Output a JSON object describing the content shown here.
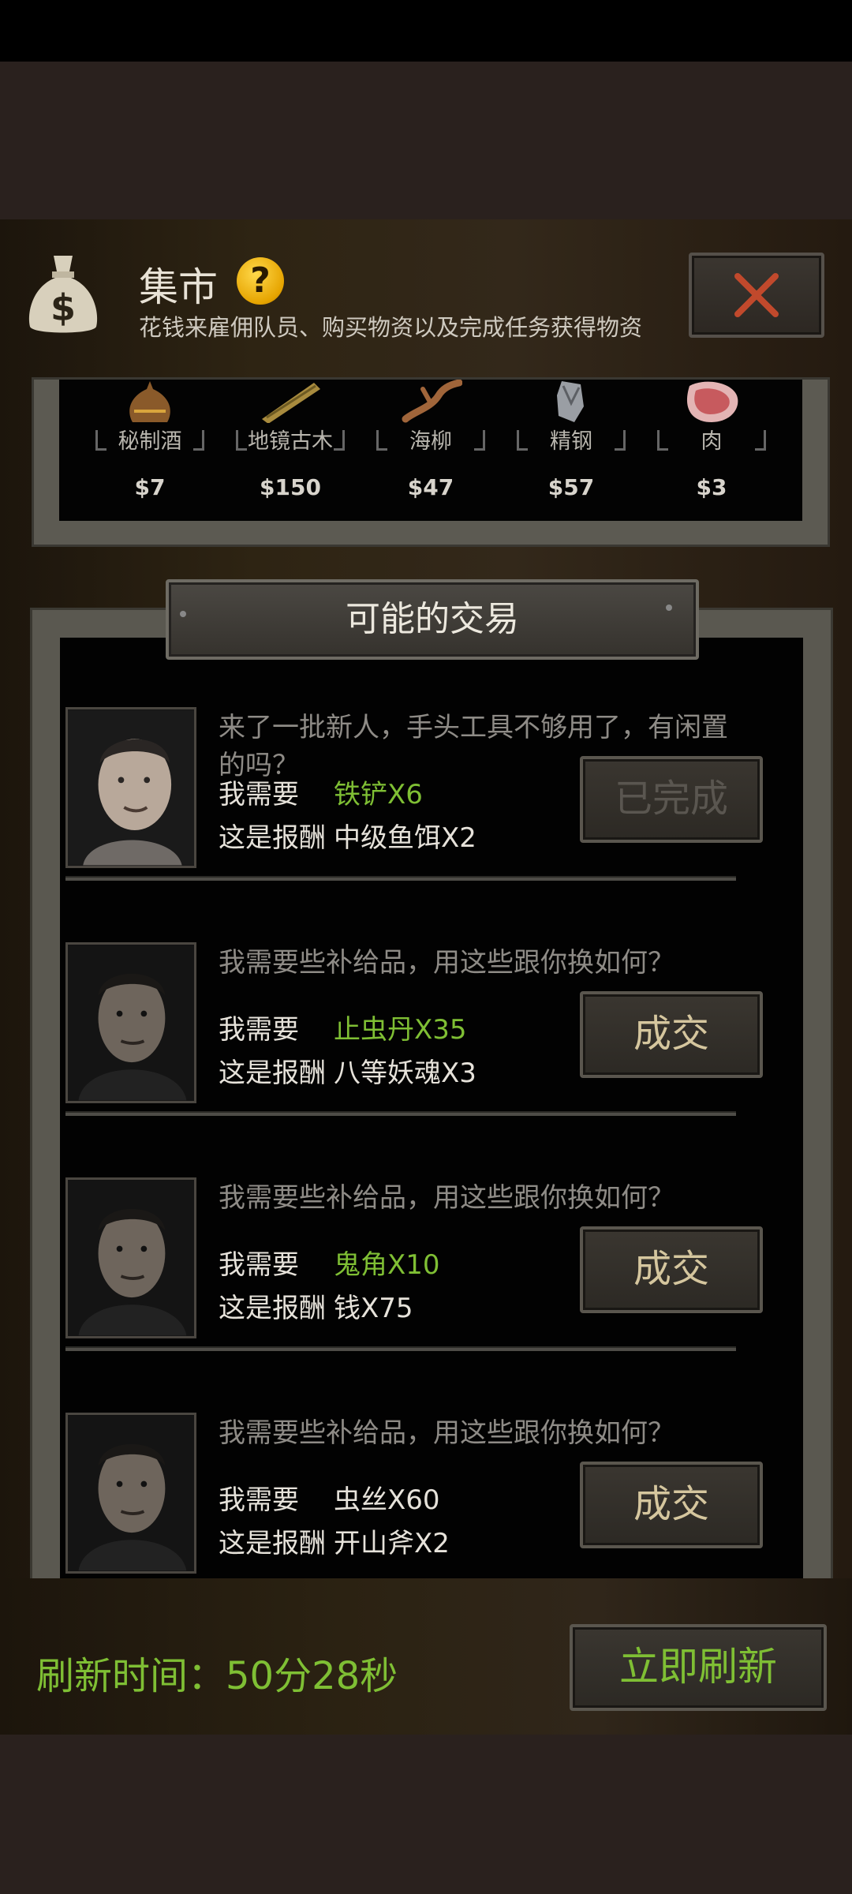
{
  "header": {
    "title": "集市",
    "help": "?",
    "subtitle": "花钱来雇佣队员、购买物资以及完成任务获得物资"
  },
  "items": [
    {
      "name": "秘制酒",
      "price": "$7",
      "icon": "wine-jug-icon"
    },
    {
      "name": "地镜古木",
      "price": "$150",
      "icon": "ancient-wood-icon"
    },
    {
      "name": "海柳",
      "price": "$47",
      "icon": "sea-willow-icon"
    },
    {
      "name": "精钢",
      "price": "$57",
      "icon": "steel-ore-icon"
    },
    {
      "name": "肉",
      "price": "$3",
      "icon": "meat-icon"
    }
  ],
  "trades_title": "可能的交易",
  "trades": [
    {
      "desc": "来了一批新人，手头工具不够用了，有闲置的吗？",
      "need_label": "我需要",
      "need": "铁铲X6",
      "reward_label": "这是报酬",
      "reward": "中级鱼饵X2",
      "button": "已完成"
    },
    {
      "desc": "我需要些补给品，用这些跟你换如何？",
      "need_label": "我需要",
      "need": "止虫丹X35",
      "reward_label": "这是报酬",
      "reward": "八等妖魂X3",
      "button": "成交"
    },
    {
      "desc": "我需要些补给品，用这些跟你换如何？",
      "need_label": "我需要",
      "need": "鬼角X10",
      "reward_label": "这是报酬",
      "reward": "钱X75",
      "button": "成交"
    },
    {
      "desc": "我需要些补给品，用这些跟你换如何？",
      "need_label": "我需要",
      "need": "虫丝X60",
      "reward_label": "这是报酬",
      "reward": "开山斧X2",
      "button": "成交"
    }
  ],
  "footer": {
    "refresh_time": "刷新时间：50分28秒",
    "refresh_button": "立即刷新"
  },
  "colors": {
    "green": "#7fbf34",
    "gold": "#e6a400"
  }
}
